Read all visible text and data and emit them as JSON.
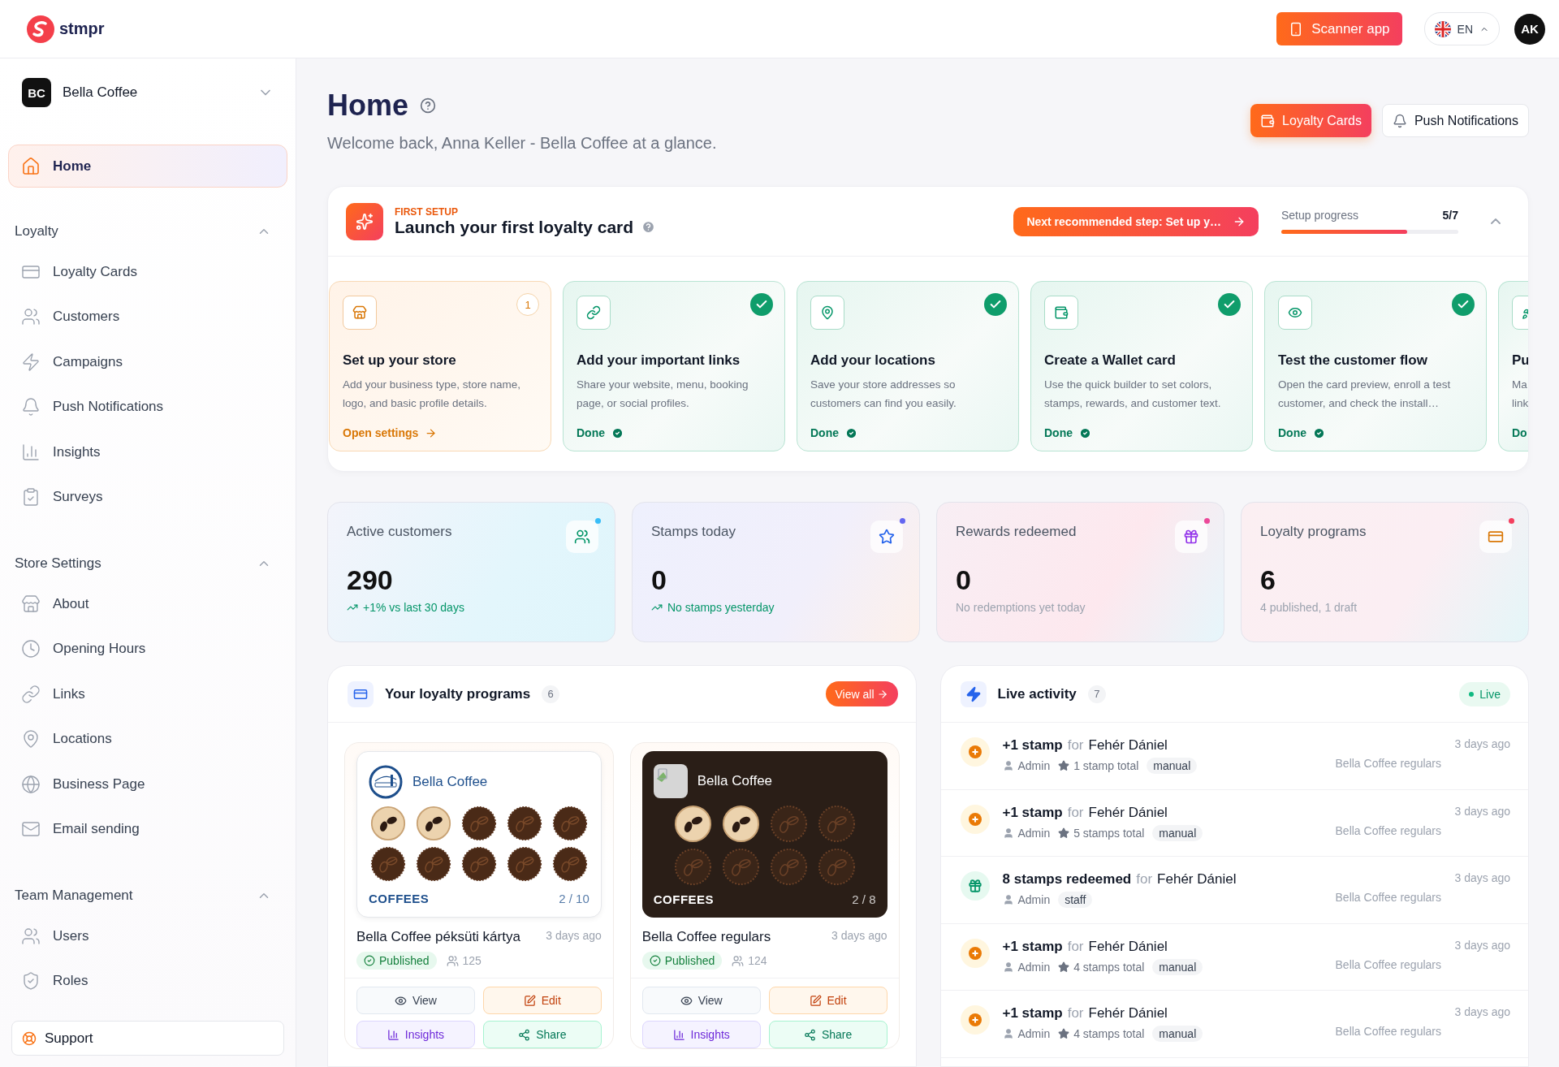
{
  "topbar": {
    "logo": "stmpr",
    "scanner_button": "Scanner app",
    "language": "EN",
    "avatar": "AK"
  },
  "sidebar": {
    "store": {
      "initials": "BC",
      "name": "Bella Coffee"
    },
    "nav": [
      {
        "label": "Home",
        "selected": true
      }
    ],
    "sections": [
      {
        "title": "Loyalty",
        "expanded": true,
        "items": [
          {
            "label": "Loyalty Cards",
            "selected": false
          },
          {
            "label": "Customers",
            "selected": false
          },
          {
            "label": "Campaigns",
            "selected": false
          },
          {
            "label": "Push Notifications",
            "selected": false
          },
          {
            "label": "Insights",
            "selected": false
          },
          {
            "label": "Surveys",
            "selected": false
          }
        ]
      },
      {
        "title": "Store Settings",
        "expanded": true,
        "items": [
          {
            "label": "About",
            "selected": false
          },
          {
            "label": "Opening Hours",
            "selected": false
          },
          {
            "label": "Links",
            "selected": false
          },
          {
            "label": "Locations",
            "selected": false
          },
          {
            "label": "Business Page",
            "selected": false
          },
          {
            "label": "Email sending",
            "selected": false
          }
        ]
      },
      {
        "title": "Team Management",
        "expanded": true,
        "items": [
          {
            "label": "Users",
            "selected": false
          },
          {
            "label": "Roles",
            "selected": false
          }
        ]
      }
    ],
    "support": "Support"
  },
  "header": {
    "title": "Home",
    "subtitle": "Welcome back, Anna Keller - Bella Coffee at a glance.",
    "buttons": [
      {
        "label": "Loyalty Cards",
        "kind": "primary"
      },
      {
        "label": "Push Notifications",
        "kind": "secondary"
      }
    ]
  },
  "setup": {
    "eyebrow": "FIRST SETUP",
    "title": "Launch your first loyalty card",
    "next_step": "Next recommended step: Set up y…",
    "progress_label": "Setup progress",
    "progress_count": "5/7",
    "level": 0.71,
    "expanded": true,
    "steps": [
      {
        "title": "Set up your store",
        "description": "Add your business type, store name, logo, and basic profile details.",
        "action": "Open settings",
        "badge": "1",
        "done": false,
        "partial": false
      },
      {
        "title": "Add your important links",
        "description": "Share your website, menu, booking page, or social profiles.",
        "action": "Done",
        "done": true,
        "partial": false
      },
      {
        "title": "Add your locations",
        "description": "Save your store addresses so customers can find you easily.",
        "action": "Done",
        "done": true,
        "partial": false
      },
      {
        "title": "Create a Wallet card",
        "description": "Use the quick builder to set colors, stamps, rewards, and customer text.",
        "action": "Done",
        "done": true,
        "partial": false
      },
      {
        "title": "Test the customer flow",
        "description": "Open the card preview, enroll a test customer, and check the install…",
        "action": "Done",
        "done": true,
        "partial": false
      },
      {
        "title": "Pu",
        "description": "Ma link",
        "action": "Do",
        "done": true,
        "partial": true
      }
    ]
  },
  "stats": [
    {
      "label": "Active customers",
      "value": "290",
      "note": "+1% vs last 30 days",
      "trend": true,
      "color": "#38bdf8"
    },
    {
      "label": "Stamps today",
      "value": "0",
      "note": "No stamps yesterday",
      "trend": true,
      "color": "#6366f1"
    },
    {
      "label": "Rewards redeemed",
      "value": "0",
      "note": "No redemptions yet today",
      "trend": false,
      "color": "#ec4899"
    },
    {
      "label": "Loyalty programs",
      "value": "6",
      "note": "4 published, 1 draft",
      "trend": false,
      "color": "#f43f5e"
    }
  ],
  "programs": {
    "title": "Your loyalty programs",
    "count": "6",
    "view_all": "View all",
    "items": [
      {
        "kind": "light",
        "brand": "Bella Coffee",
        "stamp_label": "COFFEES",
        "stamp_count": "2 / 10",
        "stamps": [
          {
            "filled": true
          },
          {
            "filled": true
          },
          {
            "filled": false
          },
          {
            "filled": false
          },
          {
            "filled": false
          },
          {
            "filled": false
          },
          {
            "filled": false
          },
          {
            "filled": false
          },
          {
            "filled": false
          },
          {
            "filled": false
          }
        ],
        "name": "Bella Coffee péksüti kártya",
        "time": "3 days ago",
        "status": "Published",
        "members": "125",
        "actions": [
          {
            "label": "View",
            "kind": "view"
          },
          {
            "label": "Edit",
            "kind": "edit"
          },
          {
            "label": "Insights",
            "kind": "insights"
          },
          {
            "label": "Share",
            "kind": "share"
          }
        ]
      },
      {
        "kind": "dark",
        "brand": "Bella Coffee",
        "stamp_label": "COFFEES",
        "stamp_count": "2 / 8",
        "stamps": [
          {
            "filled": true
          },
          {
            "filled": true
          },
          {
            "filled": false
          },
          {
            "filled": false
          },
          {
            "filled": false
          },
          {
            "filled": false
          },
          {
            "filled": false
          },
          {
            "filled": false
          }
        ],
        "name": "Bella Coffee regulars",
        "time": "3 days ago",
        "status": "Published",
        "members": "124",
        "actions": [
          {
            "label": "View",
            "kind": "view"
          },
          {
            "label": "Edit",
            "kind": "edit"
          },
          {
            "label": "Insights",
            "kind": "insights"
          },
          {
            "label": "Share",
            "kind": "share"
          }
        ]
      }
    ]
  },
  "activity": {
    "title": "Live activity",
    "count": "7",
    "live": "Live",
    "rows": [
      {
        "kind": "stamp",
        "action": "+1 stamp",
        "connector": "for",
        "customer": "Fehér Dániel",
        "actor": "Admin",
        "total": "1 stamp total",
        "tag": "manual",
        "program": "Bella Coffee regulars",
        "time": "3 days ago"
      },
      {
        "kind": "stamp",
        "action": "+1 stamp",
        "connector": "for",
        "customer": "Fehér Dániel",
        "actor": "Admin",
        "total": "5 stamps total",
        "tag": "manual",
        "program": "Bella Coffee regulars",
        "time": "3 days ago"
      },
      {
        "kind": "redeem",
        "action": "8 stamps redeemed",
        "connector": "for",
        "customer": "Fehér Dániel",
        "actor": "Admin",
        "tag": "staff",
        "program": "Bella Coffee regulars",
        "time": "3 days ago"
      },
      {
        "kind": "stamp",
        "action": "+1 stamp",
        "connector": "for",
        "customer": "Fehér Dániel",
        "actor": "Admin",
        "total": "4 stamps total",
        "tag": "manual",
        "program": "Bella Coffee regulars",
        "time": "3 days ago"
      },
      {
        "kind": "stamp",
        "action": "+1 stamp",
        "connector": "for",
        "customer": "Fehér Dániel",
        "actor": "Admin",
        "total": "4 stamps total",
        "tag": "manual",
        "program": "Bella Coffee regulars",
        "time": "3 days ago"
      }
    ]
  }
}
